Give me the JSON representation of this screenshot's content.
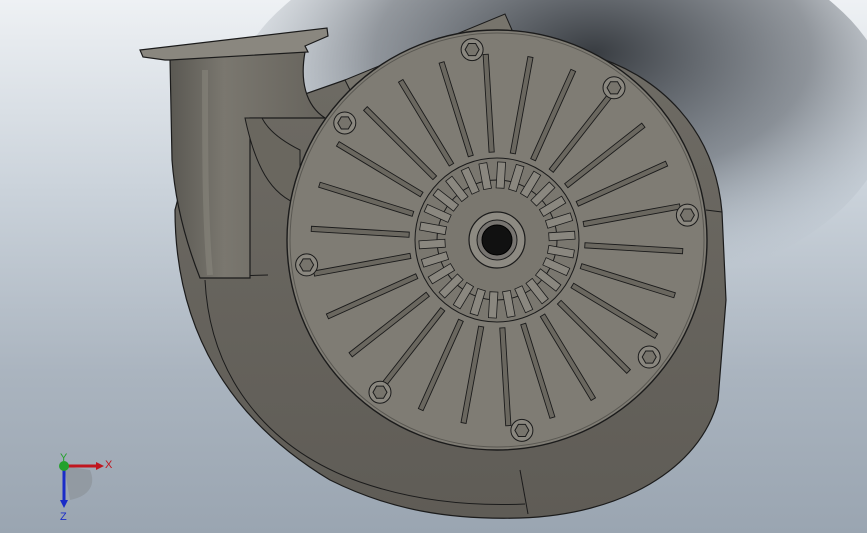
{
  "viewport": {
    "background_top": "#eef1f4",
    "background_bottom": "#9aa5b1",
    "model_color": "#7f7c74",
    "edge_color": "#1b1b1b"
  },
  "model": {
    "fins_outer_count": 26,
    "fins_inner_count": 26,
    "bolt_count": 8
  },
  "triad": {
    "x_label": "X",
    "y_label": "Y",
    "z_label": "Z",
    "x_color": "#c0161f",
    "y_color": "#23a12b",
    "z_color": "#1a2cc8"
  }
}
